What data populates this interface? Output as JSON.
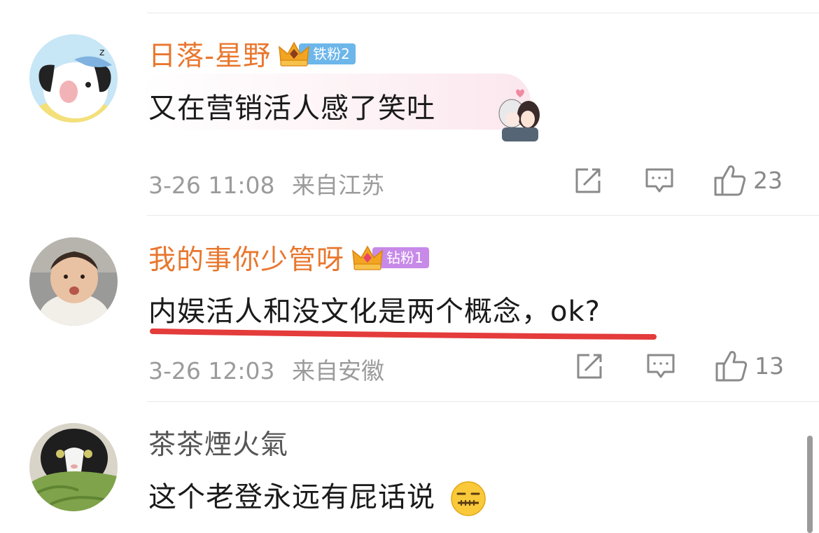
{
  "comments": [
    {
      "username": "日落-星野",
      "badge": "铁粉2",
      "text": "又在营销活人感了笑吐",
      "date": "3-26 11:08",
      "location": "来自江苏",
      "likes": "23"
    },
    {
      "username": "我的事你少管呀",
      "badge": "钻粉1",
      "text": "内娱活人和没文化是两个概念，ok?",
      "date": "3-26 12:03",
      "location": "来自安徽",
      "likes": "13"
    },
    {
      "username": "茶茶煙火氣",
      "text": "这个老登永远有屁话说"
    }
  ],
  "colors": {
    "username": "#e8772e",
    "badge_blue": "#6cb6ea",
    "badge_purple": "#c78ae8",
    "underline": "#e43b3b"
  },
  "icons": [
    "repost-icon",
    "comment-icon",
    "thumbs-up-icon",
    "crown-icon",
    "zipper-mouth-emoji-icon"
  ]
}
